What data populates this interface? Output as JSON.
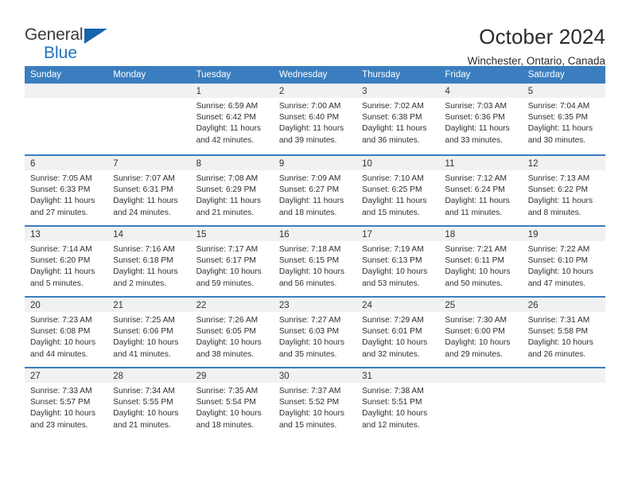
{
  "logo": {
    "word_top": "General",
    "word_bottom": "Blue",
    "triangle_color": "#1464ac",
    "blue_text_color": "#1f72bd"
  },
  "header": {
    "title": "October 2024",
    "subtitle": "Winchester, Ontario, Canada"
  },
  "theme": {
    "header_blue": "#3a7ebf",
    "day_band_gray": "#f1f1f1",
    "text_color": "#2f2f2f"
  },
  "weekdays": [
    "Sunday",
    "Monday",
    "Tuesday",
    "Wednesday",
    "Thursday",
    "Friday",
    "Saturday"
  ],
  "weeks": [
    [
      {
        "day": "",
        "lines": []
      },
      {
        "day": "",
        "lines": []
      },
      {
        "day": "1",
        "lines": [
          "Sunrise: 6:59 AM",
          "Sunset: 6:42 PM",
          "Daylight: 11 hours",
          "and 42 minutes."
        ]
      },
      {
        "day": "2",
        "lines": [
          "Sunrise: 7:00 AM",
          "Sunset: 6:40 PM",
          "Daylight: 11 hours",
          "and 39 minutes."
        ]
      },
      {
        "day": "3",
        "lines": [
          "Sunrise: 7:02 AM",
          "Sunset: 6:38 PM",
          "Daylight: 11 hours",
          "and 36 minutes."
        ]
      },
      {
        "day": "4",
        "lines": [
          "Sunrise: 7:03 AM",
          "Sunset: 6:36 PM",
          "Daylight: 11 hours",
          "and 33 minutes."
        ]
      },
      {
        "day": "5",
        "lines": [
          "Sunrise: 7:04 AM",
          "Sunset: 6:35 PM",
          "Daylight: 11 hours",
          "and 30 minutes."
        ]
      }
    ],
    [
      {
        "day": "6",
        "lines": [
          "Sunrise: 7:05 AM",
          "Sunset: 6:33 PM",
          "Daylight: 11 hours",
          "and 27 minutes."
        ]
      },
      {
        "day": "7",
        "lines": [
          "Sunrise: 7:07 AM",
          "Sunset: 6:31 PM",
          "Daylight: 11 hours",
          "and 24 minutes."
        ]
      },
      {
        "day": "8",
        "lines": [
          "Sunrise: 7:08 AM",
          "Sunset: 6:29 PM",
          "Daylight: 11 hours",
          "and 21 minutes."
        ]
      },
      {
        "day": "9",
        "lines": [
          "Sunrise: 7:09 AM",
          "Sunset: 6:27 PM",
          "Daylight: 11 hours",
          "and 18 minutes."
        ]
      },
      {
        "day": "10",
        "lines": [
          "Sunrise: 7:10 AM",
          "Sunset: 6:25 PM",
          "Daylight: 11 hours",
          "and 15 minutes."
        ]
      },
      {
        "day": "11",
        "lines": [
          "Sunrise: 7:12 AM",
          "Sunset: 6:24 PM",
          "Daylight: 11 hours",
          "and 11 minutes."
        ]
      },
      {
        "day": "12",
        "lines": [
          "Sunrise: 7:13 AM",
          "Sunset: 6:22 PM",
          "Daylight: 11 hours",
          "and 8 minutes."
        ]
      }
    ],
    [
      {
        "day": "13",
        "lines": [
          "Sunrise: 7:14 AM",
          "Sunset: 6:20 PM",
          "Daylight: 11 hours",
          "and 5 minutes."
        ]
      },
      {
        "day": "14",
        "lines": [
          "Sunrise: 7:16 AM",
          "Sunset: 6:18 PM",
          "Daylight: 11 hours",
          "and 2 minutes."
        ]
      },
      {
        "day": "15",
        "lines": [
          "Sunrise: 7:17 AM",
          "Sunset: 6:17 PM",
          "Daylight: 10 hours",
          "and 59 minutes."
        ]
      },
      {
        "day": "16",
        "lines": [
          "Sunrise: 7:18 AM",
          "Sunset: 6:15 PM",
          "Daylight: 10 hours",
          "and 56 minutes."
        ]
      },
      {
        "day": "17",
        "lines": [
          "Sunrise: 7:19 AM",
          "Sunset: 6:13 PM",
          "Daylight: 10 hours",
          "and 53 minutes."
        ]
      },
      {
        "day": "18",
        "lines": [
          "Sunrise: 7:21 AM",
          "Sunset: 6:11 PM",
          "Daylight: 10 hours",
          "and 50 minutes."
        ]
      },
      {
        "day": "19",
        "lines": [
          "Sunrise: 7:22 AM",
          "Sunset: 6:10 PM",
          "Daylight: 10 hours",
          "and 47 minutes."
        ]
      }
    ],
    [
      {
        "day": "20",
        "lines": [
          "Sunrise: 7:23 AM",
          "Sunset: 6:08 PM",
          "Daylight: 10 hours",
          "and 44 minutes."
        ]
      },
      {
        "day": "21",
        "lines": [
          "Sunrise: 7:25 AM",
          "Sunset: 6:06 PM",
          "Daylight: 10 hours",
          "and 41 minutes."
        ]
      },
      {
        "day": "22",
        "lines": [
          "Sunrise: 7:26 AM",
          "Sunset: 6:05 PM",
          "Daylight: 10 hours",
          "and 38 minutes."
        ]
      },
      {
        "day": "23",
        "lines": [
          "Sunrise: 7:27 AM",
          "Sunset: 6:03 PM",
          "Daylight: 10 hours",
          "and 35 minutes."
        ]
      },
      {
        "day": "24",
        "lines": [
          "Sunrise: 7:29 AM",
          "Sunset: 6:01 PM",
          "Daylight: 10 hours",
          "and 32 minutes."
        ]
      },
      {
        "day": "25",
        "lines": [
          "Sunrise: 7:30 AM",
          "Sunset: 6:00 PM",
          "Daylight: 10 hours",
          "and 29 minutes."
        ]
      },
      {
        "day": "26",
        "lines": [
          "Sunrise: 7:31 AM",
          "Sunset: 5:58 PM",
          "Daylight: 10 hours",
          "and 26 minutes."
        ]
      }
    ],
    [
      {
        "day": "27",
        "lines": [
          "Sunrise: 7:33 AM",
          "Sunset: 5:57 PM",
          "Daylight: 10 hours",
          "and 23 minutes."
        ]
      },
      {
        "day": "28",
        "lines": [
          "Sunrise: 7:34 AM",
          "Sunset: 5:55 PM",
          "Daylight: 10 hours",
          "and 21 minutes."
        ]
      },
      {
        "day": "29",
        "lines": [
          "Sunrise: 7:35 AM",
          "Sunset: 5:54 PM",
          "Daylight: 10 hours",
          "and 18 minutes."
        ]
      },
      {
        "day": "30",
        "lines": [
          "Sunrise: 7:37 AM",
          "Sunset: 5:52 PM",
          "Daylight: 10 hours",
          "and 15 minutes."
        ]
      },
      {
        "day": "31",
        "lines": [
          "Sunrise: 7:38 AM",
          "Sunset: 5:51 PM",
          "Daylight: 10 hours",
          "and 12 minutes."
        ]
      },
      {
        "day": "",
        "lines": []
      },
      {
        "day": "",
        "lines": []
      }
    ]
  ]
}
